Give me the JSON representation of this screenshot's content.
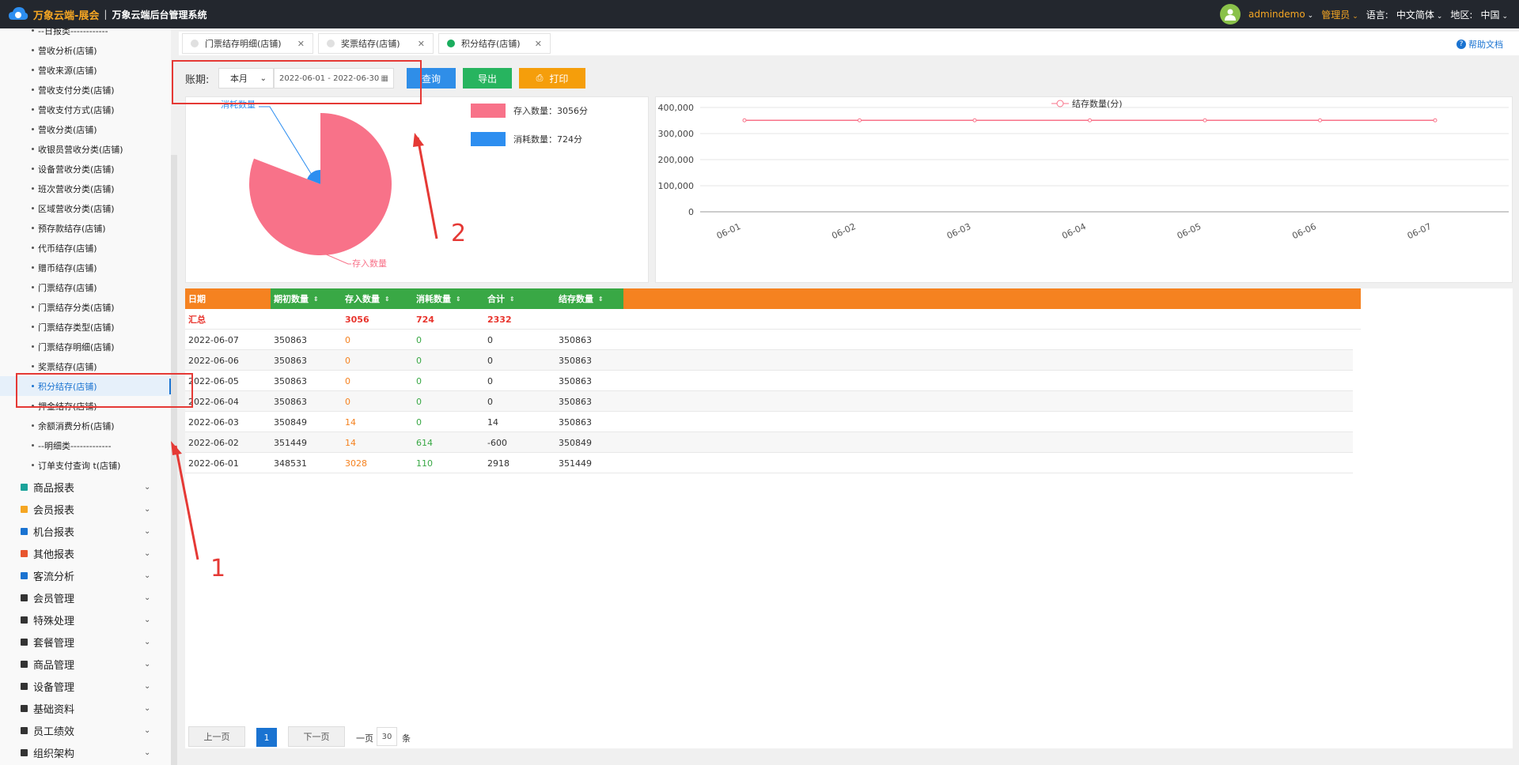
{
  "header": {
    "brand": "万象云端-展会",
    "system_name": "万象云端后台管理系统",
    "user": "admindemo",
    "role": "管理员",
    "language_label": "语言:",
    "language_value": "中文简体",
    "region_label": "地区:",
    "region_value": "中国"
  },
  "sidebar": {
    "sub_items": [
      "--日报类------------",
      "营收分析(店铺)",
      "营收来源(店铺)",
      "营收支付分类(店铺)",
      "营收支付方式(店铺)",
      "营收分类(店铺)",
      "收银员营收分类(店铺)",
      "设备营收分类(店铺)",
      "班次营收分类(店铺)",
      "区域营收分类(店铺)",
      "预存款结存(店铺)",
      "代币结存(店铺)",
      "赠币结存(店铺)",
      "门票结存(店铺)",
      "门票结存分类(店铺)",
      "门票结存类型(店铺)",
      "门票结存明细(店铺)",
      "奖票结存(店铺)",
      "积分结存(店铺)",
      "押金结存(店铺)",
      "余额消费分析(店铺)",
      "--明细类-------------",
      "订单支付查询 t(店铺)"
    ],
    "active_index": 18,
    "groups": [
      {
        "label": "商品报表",
        "icon": "chart-icon",
        "color": "#1aa39a"
      },
      {
        "label": "会员报表",
        "icon": "member-report-icon",
        "color": "#f5a623"
      },
      {
        "label": "机台报表",
        "icon": "machine-icon",
        "color": "#1a73d1"
      },
      {
        "label": "其他报表",
        "icon": "layers-icon",
        "color": "#e8552e"
      },
      {
        "label": "客流分析",
        "icon": "target-icon",
        "color": "#1a73d1"
      },
      {
        "label": "会员管理",
        "icon": "user-icon",
        "color": "#333333"
      },
      {
        "label": "特殊处理",
        "icon": "warning-icon",
        "color": "#333333"
      },
      {
        "label": "套餐管理",
        "icon": "edit-icon",
        "color": "#333333"
      },
      {
        "label": "商品管理",
        "icon": "swap-icon",
        "color": "#333333"
      },
      {
        "label": "设备管理",
        "icon": "device-icon",
        "color": "#333333"
      },
      {
        "label": "基础资料",
        "icon": "file-icon",
        "color": "#333333"
      },
      {
        "label": "员工绩效",
        "icon": "gear-icon",
        "color": "#333333"
      },
      {
        "label": "组织架构",
        "icon": "org-icon",
        "color": "#333333"
      }
    ]
  },
  "tabs": [
    {
      "label": "门票结存明细(店铺)",
      "active": false
    },
    {
      "label": "奖票结存(店铺)",
      "active": false
    },
    {
      "label": "积分结存(店铺)",
      "active": true
    }
  ],
  "help_label": "帮助文档",
  "filter": {
    "period_label": "账期:",
    "period_value": "本月",
    "date_range": "2022-06-01 - 2022-06-30",
    "query_label": "查询",
    "export_label": "导出",
    "print_label": "打印"
  },
  "chart_data": [
    {
      "type": "pie",
      "slices": [
        {
          "name": "存入数量",
          "value": 3056,
          "color": "#f87289"
        },
        {
          "name": "消耗数量",
          "value": 724,
          "color": "#2d8ef0"
        }
      ],
      "legend": [
        "存入数量：3056分",
        "消耗数量：724分"
      ],
      "legend_position": "top-right"
    },
    {
      "type": "line",
      "series": [
        {
          "name": "结存数量(分)",
          "color": "#f87289",
          "values": [
            350863,
            350863,
            350863,
            350863,
            350863,
            350863,
            350863
          ]
        }
      ],
      "x": [
        "06-01",
        "06-02",
        "06-03",
        "06-04",
        "06-05",
        "06-06",
        "06-07"
      ],
      "y_ticks": [
        "400,000",
        "300,000",
        "200,000",
        "100,000",
        "0"
      ],
      "ylim": [
        0,
        400000
      ],
      "grid": true,
      "legend_position": "top"
    }
  ],
  "table": {
    "columns": [
      "日期",
      "期初数量",
      "存入数量",
      "消耗数量",
      "合计",
      "结存数量"
    ],
    "summary": {
      "label": "汇总",
      "deposit": "3056",
      "consume": "724",
      "total": "2332"
    },
    "rows": [
      {
        "date": "2022-06-07",
        "opening": "350863",
        "deposit": "0",
        "consume": "0",
        "total": "0",
        "balance": "350863"
      },
      {
        "date": "2022-06-06",
        "opening": "350863",
        "deposit": "0",
        "consume": "0",
        "total": "0",
        "balance": "350863"
      },
      {
        "date": "2022-06-05",
        "opening": "350863",
        "deposit": "0",
        "consume": "0",
        "total": "0",
        "balance": "350863"
      },
      {
        "date": "2022-06-04",
        "opening": "350863",
        "deposit": "0",
        "consume": "0",
        "total": "0",
        "balance": "350863"
      },
      {
        "date": "2022-06-03",
        "opening": "350849",
        "deposit": "14",
        "consume": "0",
        "total": "14",
        "balance": "350863"
      },
      {
        "date": "2022-06-02",
        "opening": "351449",
        "deposit": "14",
        "consume": "614",
        "total": "-600",
        "balance": "350849"
      },
      {
        "date": "2022-06-01",
        "opening": "348531",
        "deposit": "3028",
        "consume": "110",
        "total": "2918",
        "balance": "351449"
      }
    ]
  },
  "pager": {
    "prev_label": "上一页",
    "current_page": "1",
    "next_label": "下一页",
    "per_page_prefix": "一页",
    "page_size": "30",
    "per_page_suffix": "条"
  },
  "annotations": {
    "arrow1": "1",
    "arrow2": "2"
  }
}
